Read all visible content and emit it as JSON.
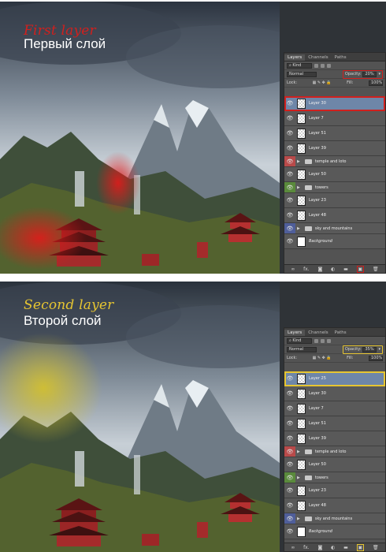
{
  "colors": {
    "red_marker": "#d0201e",
    "yellow_marker": "#e6c531",
    "panel_bg": "#535353",
    "selected_row": "#6e86a8"
  },
  "panel_common": {
    "tabs": [
      "Layers",
      "Channels",
      "Paths"
    ],
    "filter_label": "Kind",
    "blend_mode": "Normal",
    "opacity_label": "Opacity:",
    "lock_label": "Lock:",
    "fill_label": "Fill:",
    "fill_value": "100%",
    "footer_icons": [
      "link-icon",
      "fx-icon",
      "mask-icon",
      "adjustment-icon",
      "folder-icon",
      "new-layer-icon",
      "trash-icon"
    ],
    "footer_fx": "fx."
  },
  "frame1": {
    "caption_en": "First layer",
    "caption_ru": "Первый слой",
    "caption_color": "#d0201e",
    "opacity_value": "20%",
    "layers": [
      {
        "name": "Layer 30",
        "kind": "layer",
        "selected": true
      },
      {
        "name": "Layer 7",
        "kind": "layer"
      },
      {
        "name": "Layer 51",
        "kind": "layer"
      },
      {
        "name": "Layer 39",
        "kind": "layer"
      },
      {
        "name": "temple and loto",
        "kind": "group",
        "tag": "red"
      },
      {
        "name": "Layer 50",
        "kind": "layer"
      },
      {
        "name": "towers",
        "kind": "group",
        "tag": "green"
      },
      {
        "name": "Layer 23",
        "kind": "layer"
      },
      {
        "name": "Layer 48",
        "kind": "layer"
      },
      {
        "name": "sky and mountains",
        "kind": "group",
        "tag": "blue"
      },
      {
        "name": "Background",
        "kind": "background"
      }
    ]
  },
  "frame2": {
    "caption_en": "Second layer",
    "caption_ru": "Второй слой",
    "caption_color": "#e6c531",
    "opacity_value": "35%",
    "layers": [
      {
        "name": "Layer 25",
        "kind": "layer",
        "selected": true
      },
      {
        "name": "Layer 30",
        "kind": "layer"
      },
      {
        "name": "Layer 7",
        "kind": "layer"
      },
      {
        "name": "Layer 51",
        "kind": "layer"
      },
      {
        "name": "Layer 39",
        "kind": "layer"
      },
      {
        "name": "temple and loto",
        "kind": "group",
        "tag": "red"
      },
      {
        "name": "Layer 50",
        "kind": "layer"
      },
      {
        "name": "towers",
        "kind": "group",
        "tag": "green"
      },
      {
        "name": "Layer 23",
        "kind": "layer"
      },
      {
        "name": "Layer 48",
        "kind": "layer"
      },
      {
        "name": "sky and mountains",
        "kind": "group",
        "tag": "blue"
      },
      {
        "name": "Background",
        "kind": "background"
      }
    ]
  }
}
